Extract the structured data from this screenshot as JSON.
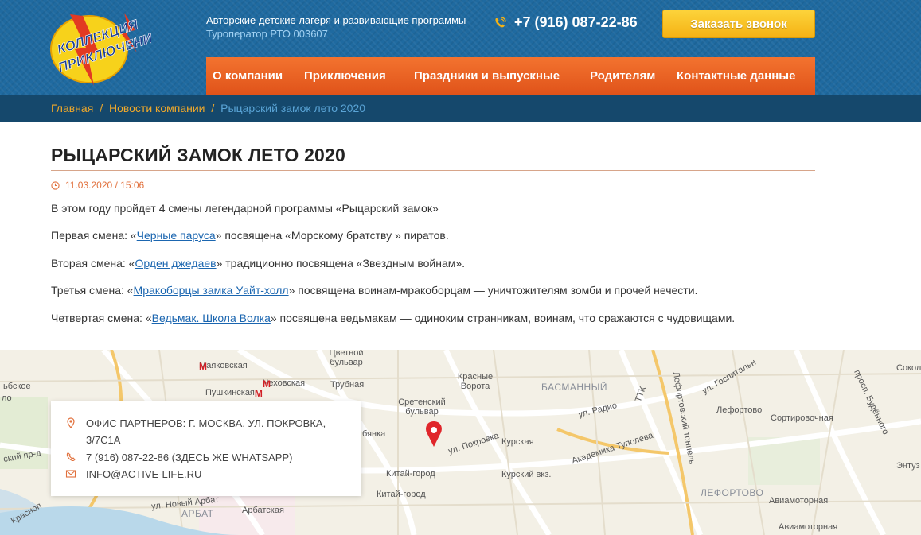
{
  "header": {
    "logo_text_line1": "КОЛЛЕКЦИЯ",
    "logo_text_line2": "ПРИКЛЮЧЕНИЙ",
    "tagline": "Авторские детские лагеря и развивающие программы",
    "tagline_sub": "Туроператор РТО 003607",
    "phone": "+7 (916) 087-22-86",
    "callback_label": "Заказать звонок",
    "nav": [
      {
        "label": "О компании"
      },
      {
        "label": "Приключения"
      },
      {
        "label": "Праздники и выпускные"
      },
      {
        "label": "Родителям"
      },
      {
        "label": "Контактные данные"
      }
    ]
  },
  "breadcrumb": {
    "home": "Главная",
    "news": "Новости компании",
    "current": "Рыцарский замок лето 2020",
    "separator": "/"
  },
  "article": {
    "title": "РЫЦАРСКИЙ ЗАМОК ЛЕТО 2020",
    "date": "11.03.2020 / 15:06",
    "intro": "В этом году пройдет 4 смены легендарной программы «Рыцарский замок»",
    "shifts": [
      {
        "prefix": "Первая смена: «",
        "link": "Черные паруса",
        "suffix": "» посвящена «Морскому братству » пиратов."
      },
      {
        "prefix": "Вторая смена: «",
        "link": "Орден джедаев",
        "suffix": "» традиционно посвящена «Звездным войнам»."
      },
      {
        "prefix": "Третья смена: «",
        "link": "Мракоборцы замка Уайт-холл",
        "suffix": "» посвящена воинам-мракоборцам — уничтожителям зомби и прочей нечести."
      },
      {
        "prefix": "Четвертая смена: «",
        "link": "Ведьмак. Школа Волка",
        "suffix": "» посвящена ведьмакам — одиноким странникам, воинам, что сражаются с чудовищами."
      }
    ]
  },
  "contact": {
    "address": "Офис партнеров: г. Москва, ул. Покровка, 3/7С1А",
    "phone": "7 (916) 087-22-86 (здесь же WhatsApp)",
    "email": "info@active-life.ru"
  },
  "map": {
    "labels": [
      {
        "text": "Маяковская",
        "metro": true
      },
      {
        "text": "Чеховская",
        "metro": true
      },
      {
        "text": "Пушкинская",
        "metro": true
      },
      {
        "text": "Цветной бульвар"
      },
      {
        "text": "Трубная",
        "metro": true
      },
      {
        "text": "Красные Ворота",
        "metro": true
      },
      {
        "text": "БАСМАННЫЙ",
        "district": true
      },
      {
        "text": "Сретенский бульвар",
        "metro": true
      },
      {
        "text": "Курская",
        "metro": true
      },
      {
        "text": "Курский вкз."
      },
      {
        "text": "Китай-город",
        "metro": true
      },
      {
        "text": "Арбатская",
        "metro": true
      },
      {
        "text": "АРБАТ",
        "district": true
      },
      {
        "text": "ЛЕФОРТОВО",
        "district": true
      },
      {
        "text": "Лефортово",
        "metro": true
      },
      {
        "text": "Сортировочная"
      },
      {
        "text": "Авиамоторная",
        "metro": true
      },
      {
        "text": "ул. Покровка"
      },
      {
        "text": "ул. Радио"
      },
      {
        "text": "Академика Туполева"
      },
      {
        "text": "ул. Новый Арбат"
      },
      {
        "text": "Лефортовский тоннель"
      },
      {
        "text": "ТТК"
      },
      {
        "text": "ул. Госпитальн"
      },
      {
        "text": "просп. Будённого"
      },
      {
        "text": "Сокол"
      },
      {
        "text": "Энтуз"
      },
      {
        "text": "Красноп"
      },
      {
        "text": "бянка"
      },
      {
        "text": "ский пр-д"
      },
      {
        "text": "ьбское"
      },
      {
        "text": "ло"
      }
    ]
  },
  "colors": {
    "header_bg": "#1f6aa0",
    "nav_orange": "#e95f20",
    "callback_yellow": "#f7be1e",
    "breadcrumb_bg": "#15486c",
    "breadcrumb_link": "#f1a92a",
    "link_blue": "#1b66b0",
    "date_orange": "#e1703c",
    "metro_red": "#d21f26"
  }
}
